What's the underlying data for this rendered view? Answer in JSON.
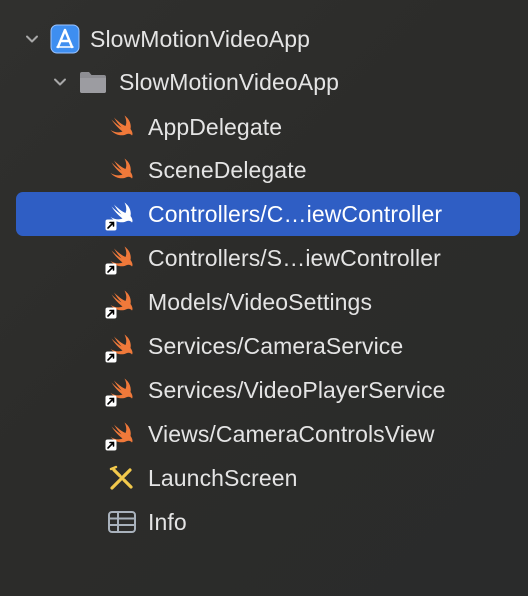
{
  "project": {
    "name": "SlowMotionVideoApp",
    "icon": "xcode-project-icon",
    "expanded": true
  },
  "group": {
    "name": "SlowMotionVideoApp",
    "icon": "folder-icon",
    "expanded": true
  },
  "files": [
    {
      "label": "AppDelegate",
      "icon": "swift-file-icon",
      "alias": false,
      "selected": false
    },
    {
      "label": "SceneDelegate",
      "icon": "swift-file-icon",
      "alias": false,
      "selected": false
    },
    {
      "label": "Controllers/C…iewController",
      "icon": "swift-file-icon",
      "alias": true,
      "selected": true
    },
    {
      "label": "Controllers/S…iewController",
      "icon": "swift-file-icon",
      "alias": true,
      "selected": false
    },
    {
      "label": "Models/VideoSettings",
      "icon": "swift-file-icon",
      "alias": true,
      "selected": false
    },
    {
      "label": "Services/CameraService",
      "icon": "swift-file-icon",
      "alias": true,
      "selected": false
    },
    {
      "label": "Services/VideoPlayerService",
      "icon": "swift-file-icon",
      "alias": true,
      "selected": false
    },
    {
      "label": "Views/CameraControlsView",
      "icon": "swift-file-icon",
      "alias": true,
      "selected": false
    },
    {
      "label": "LaunchScreen",
      "icon": "storyboard-icon",
      "alias": false,
      "selected": false
    },
    {
      "label": "Info",
      "icon": "plist-icon",
      "alias": false,
      "selected": false
    }
  ],
  "colors": {
    "selection": "#2f5ec4",
    "swift": "#f0793a",
    "folder": "#8e8e93",
    "project": "#3e8ef0",
    "storyboard": "#f2c94c"
  }
}
